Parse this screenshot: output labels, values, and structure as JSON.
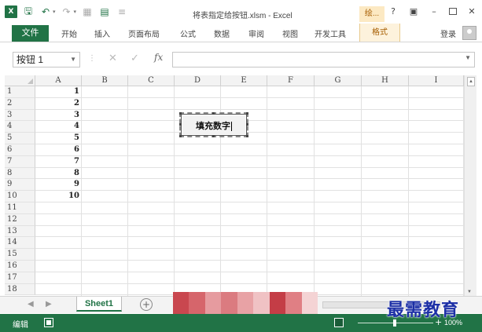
{
  "titlebar": {
    "logo": "X",
    "doc_title": "将表指定给按钮.xlsm - Excel",
    "tools_title": "绘...",
    "help": "?",
    "icons": [
      "excel-logo-icon",
      "save-icon",
      "undo-icon",
      "redo-icon",
      "screenshot-icon",
      "form-icon",
      "customize-icon"
    ]
  },
  "ribbon": {
    "file_tab": "文件",
    "tabs": [
      "开始",
      "插入",
      "页面布局",
      "公式",
      "数据",
      "审阅",
      "视图",
      "开发工具"
    ],
    "format_tab": "格式",
    "login": "登录"
  },
  "formula_bar": {
    "name_box": "按钮 1",
    "fx": "fx",
    "formula": ""
  },
  "grid": {
    "columns": [
      "A",
      "B",
      "C",
      "D",
      "E",
      "F",
      "G",
      "H",
      "I"
    ],
    "rows": [
      "1",
      "2",
      "3",
      "4",
      "5",
      "6",
      "7",
      "8",
      "9",
      "10",
      "11",
      "12",
      "13",
      "14",
      "15",
      "16",
      "17",
      "18"
    ],
    "column_a_values": [
      "1",
      "2",
      "3",
      "4",
      "5",
      "6",
      "7",
      "8",
      "9",
      "10"
    ]
  },
  "form_button": {
    "label": "填充数字"
  },
  "sheets": {
    "active": "Sheet1",
    "add": "+"
  },
  "status_bar": {
    "mode": "编辑",
    "zoom_plus": "+",
    "zoom_level": "100%"
  },
  "watermark": "最需教育",
  "colors": {
    "accent": "#217346",
    "tools_highlight": "#fce9c3",
    "watermark": "#1c2fa6"
  }
}
